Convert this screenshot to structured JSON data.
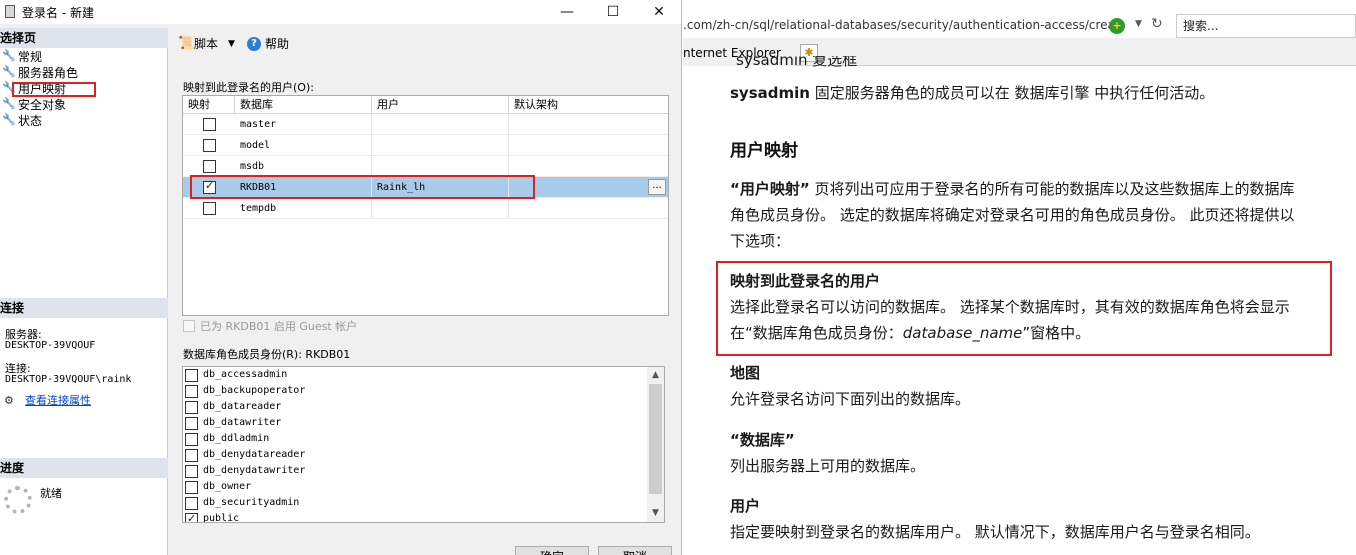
{
  "dialog": {
    "title": "登录名 - 新建",
    "window_controls": {
      "minimize": "—",
      "maximize": "☐",
      "close": "✕"
    },
    "left_pane": {
      "select_page_header": "选择页",
      "nav_items": [
        "常规",
        "服务器角色",
        "用户映射",
        "安全对象",
        "状态"
      ],
      "connection_header": "连接",
      "server_label": "服务器:",
      "server_value": "DESKTOP-39VQOUF",
      "connection_label": "连接:",
      "connection_value": "DESKTOP-39VQOUF\\raink",
      "view_conn_props": "查看连接属性",
      "progress_header": "进度",
      "progress_status": "就绪"
    },
    "toolbar": {
      "script_label": "脚本",
      "help_label": "帮助"
    },
    "mapped_users_label": "映射到此登录名的用户(O):",
    "grid_headers": [
      "映射",
      "数据库",
      "用户",
      "默认架构"
    ],
    "grid_rows": [
      {
        "mapped": false,
        "database": "master",
        "user": "",
        "schema": ""
      },
      {
        "mapped": false,
        "database": "model",
        "user": "",
        "schema": ""
      },
      {
        "mapped": false,
        "database": "msdb",
        "user": "",
        "schema": ""
      },
      {
        "mapped": true,
        "database": "RKDB01",
        "user": "Raink_lh",
        "schema": ""
      },
      {
        "mapped": false,
        "database": "tempdb",
        "user": "",
        "schema": ""
      }
    ],
    "guest_enabled_label": "已为 RKDB01 启用 Guest 帐户",
    "role_membership_label": "数据库角色成员身份(R): RKDB01",
    "roles": [
      {
        "name": "db_accessadmin",
        "checked": false
      },
      {
        "name": "db_backupoperator",
        "checked": false
      },
      {
        "name": "db_datareader",
        "checked": false
      },
      {
        "name": "db_datawriter",
        "checked": false
      },
      {
        "name": "db_ddladmin",
        "checked": false
      },
      {
        "name": "db_denydatareader",
        "checked": false
      },
      {
        "name": "db_denydatawriter",
        "checked": false
      },
      {
        "name": "db_owner",
        "checked": false
      },
      {
        "name": "db_securityadmin",
        "checked": false
      },
      {
        "name": "public",
        "checked": true
      }
    ],
    "ok_button": "确定",
    "cancel_button": "取消"
  },
  "browser": {
    "url": ".com/zh-cn/sql/relational-databases/security/authentication-access/creat",
    "search_placeholder": "搜索...",
    "tab_label": "nternet Explorer",
    "doc": {
      "line_cut": "sysadmin 复选框",
      "sysadmin_bold": "sysadmin",
      "sysadmin_text": " 固定服务器角色的成员可以在 数据库引擎 中执行任何活动。",
      "user_mapping_heading": "用户映射",
      "user_mapping_quote": "“用户映射”",
      "user_mapping_desc1": " 页将列出可应用于登录名的所有可能的数据库以及这些数据库上的数据库",
      "user_mapping_desc2": "角色成员身份。 选定的数据库将确定对登录名可用的角色成员身份。 此页还将提供以",
      "user_mapping_desc3": "下选项：",
      "mapped_users_heading": "映射到此登录名的用户",
      "mapped_users_desc1": "选择此登录名可以访问的数据库。 选择某个数据库时，其有效的数据库角色将会显示",
      "mapped_users_desc2a": "在“数据库角色成员身份：",
      "mapped_users_desc2_italic": "database_name",
      "mapped_users_desc2b": "”窗格中。",
      "map_heading": "地图",
      "map_desc": "允许登录名访问下面列出的数据库。",
      "db_heading": "“数据库”",
      "db_desc": "列出服务器上可用的数据库。",
      "user_heading": "用户",
      "user_desc": "指定要映射到登录名的数据库用户。 默认情况下，数据库用户名与登录名相同。"
    }
  }
}
